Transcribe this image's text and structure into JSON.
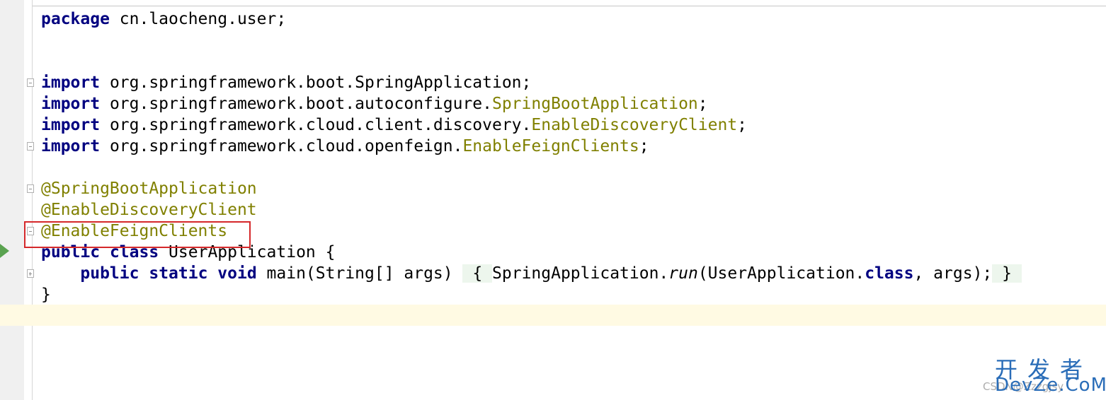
{
  "editor": {
    "lines": [
      [
        {
          "t": "package",
          "c": "kw"
        },
        {
          "t": " cn.laocheng.user;"
        }
      ],
      [],
      [],
      [
        {
          "t": "import",
          "c": "kw"
        },
        {
          "t": " org.springframework.boot.SpringApplication;"
        }
      ],
      [
        {
          "t": "import",
          "c": "kw"
        },
        {
          "t": " org.springframework.boot.autoconfigure."
        },
        {
          "t": "SpringBootApplication",
          "c": "ann"
        },
        {
          "t": ";"
        }
      ],
      [
        {
          "t": "import",
          "c": "kw"
        },
        {
          "t": " org.springframework.cloud.client.discovery."
        },
        {
          "t": "EnableDiscoveryClient",
          "c": "ann"
        },
        {
          "t": ";"
        }
      ],
      [
        {
          "t": "import",
          "c": "kw"
        },
        {
          "t": " org.springframework.cloud.openfeign."
        },
        {
          "t": "EnableFeignClients",
          "c": "ann"
        },
        {
          "t": ";"
        }
      ],
      [],
      [
        {
          "t": "@SpringBootApplication",
          "c": "ann"
        }
      ],
      [
        {
          "t": "@EnableDiscoveryClient",
          "c": "ann"
        }
      ],
      [
        {
          "t": "@EnableFeignClients",
          "c": "ann"
        }
      ],
      [
        {
          "t": "public",
          "c": "kw"
        },
        {
          "t": " "
        },
        {
          "t": "class",
          "c": "kw"
        },
        {
          "t": " UserApplication {"
        }
      ],
      [
        {
          "t": "    "
        },
        {
          "t": "public",
          "c": "kw"
        },
        {
          "t": " "
        },
        {
          "t": "static",
          "c": "kw"
        },
        {
          "t": " "
        },
        {
          "t": "void",
          "c": "kw"
        },
        {
          "t": " main(String[] args) "
        },
        {
          "t": " { ",
          "c": "fold-hl"
        },
        {
          "t": "SpringApplication."
        },
        {
          "t": "run",
          "c": "it"
        },
        {
          "t": "(UserApplication."
        },
        {
          "t": "class",
          "c": "kw"
        },
        {
          "t": ", args);"
        },
        {
          "t": " } ",
          "c": "fold-hl"
        }
      ],
      [
        {
          "t": "}"
        }
      ],
      []
    ]
  },
  "watermark": {
    "cn": "开发者",
    "en": "DevZe.CoM",
    "small": "CSDN@Zzzgjsy"
  },
  "colors": {
    "keyword": "#000080",
    "annotation": "#808000",
    "caret_line": "#fffae3",
    "highlight_box": "#d5282a",
    "run_icon": "#5aa350"
  }
}
